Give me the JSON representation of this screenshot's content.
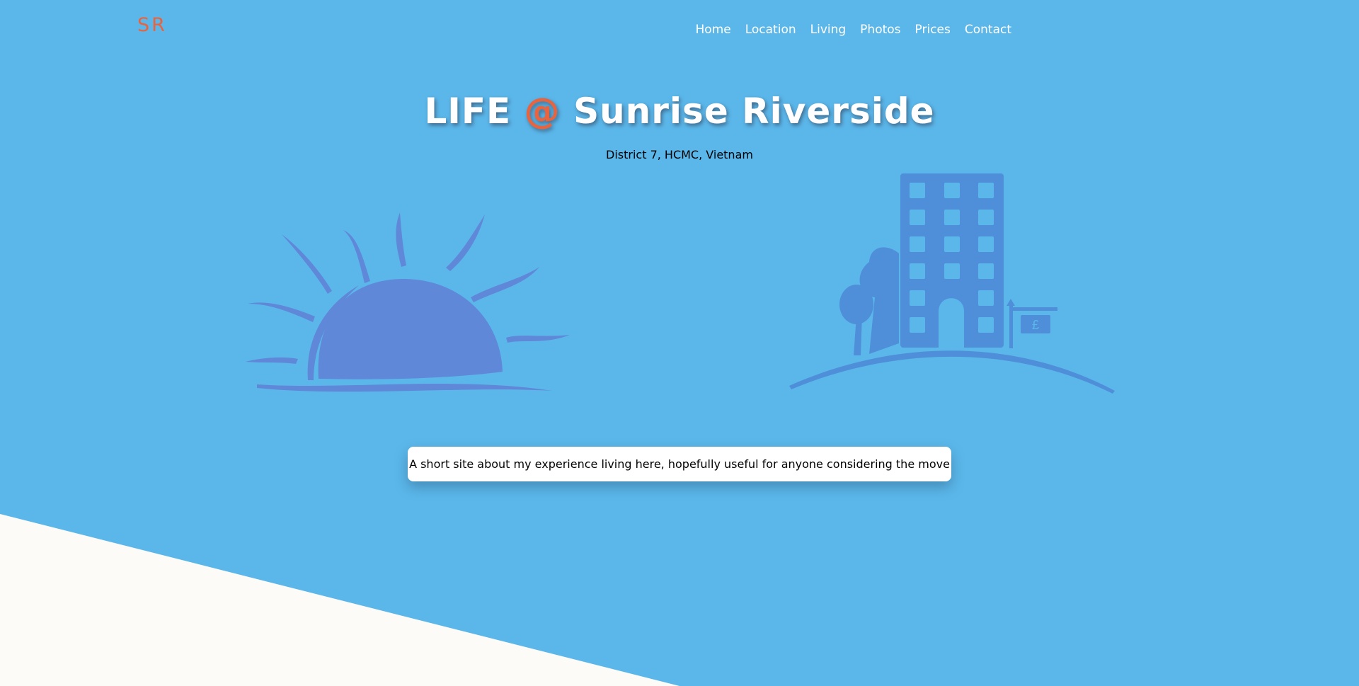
{
  "brand": {
    "logo": "SR",
    "accent": "#e8643f"
  },
  "nav": {
    "items": [
      {
        "label": "Home"
      },
      {
        "label": "Location"
      },
      {
        "label": "Living"
      },
      {
        "label": "Photos"
      },
      {
        "label": "Prices"
      },
      {
        "label": "Contact"
      }
    ]
  },
  "hero": {
    "title_part1": "LIFE",
    "title_at": "@",
    "title_part2": "Sunrise Riverside",
    "subtitle": "District 7, HCMC, Vietnam",
    "intro": "A short site about my experience living here, hopefully useful for anyone considering the move",
    "sign_symbol": "£"
  },
  "colors": {
    "background": "#5bb7ea",
    "sun": "#6088d8",
    "building": "#4f8fd9",
    "corner": "#fcfbf7"
  },
  "icons": [
    "sunrise-icon",
    "apartment-building-icon"
  ]
}
